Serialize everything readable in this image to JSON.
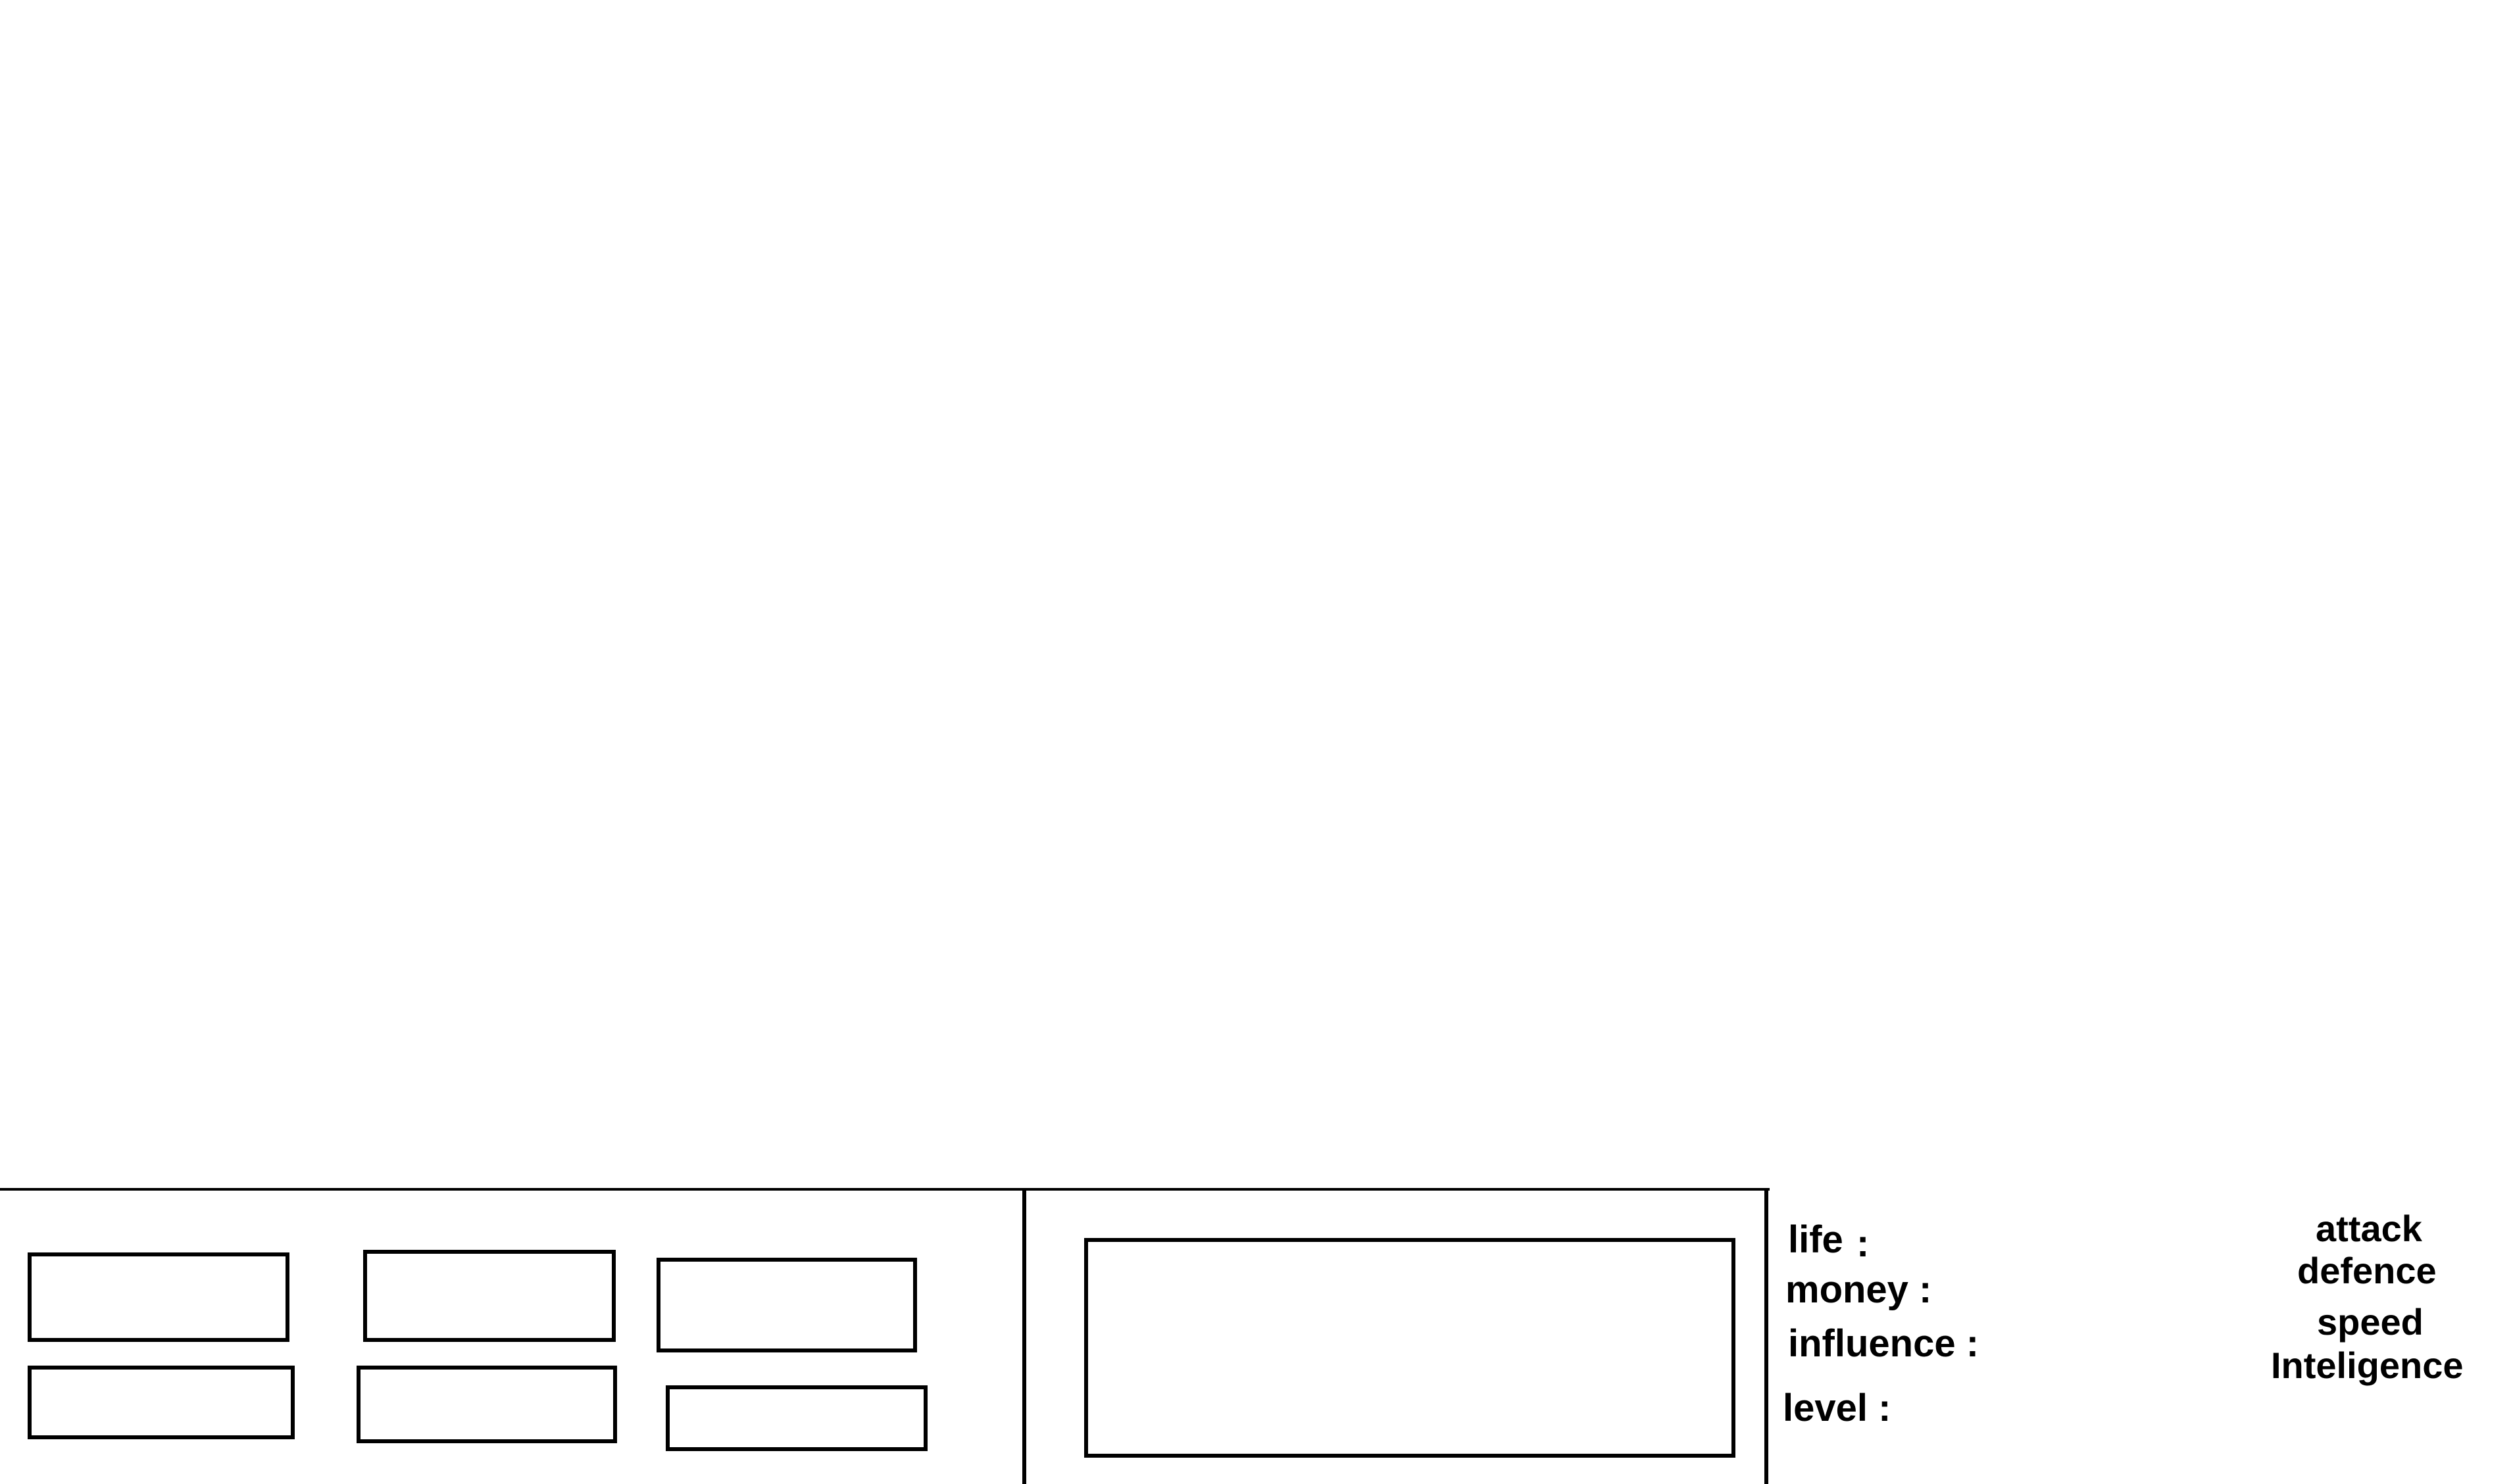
{
  "hud": {
    "stats": {
      "life_label": "life",
      "life_colon": ":",
      "money_label": "money :",
      "influence_label": "influence :",
      "level_label": "level :"
    },
    "attributes": {
      "attack_label": "attack",
      "defence_label": "defence",
      "speed_label": "speed",
      "inteligence_label": "Inteligence"
    }
  }
}
